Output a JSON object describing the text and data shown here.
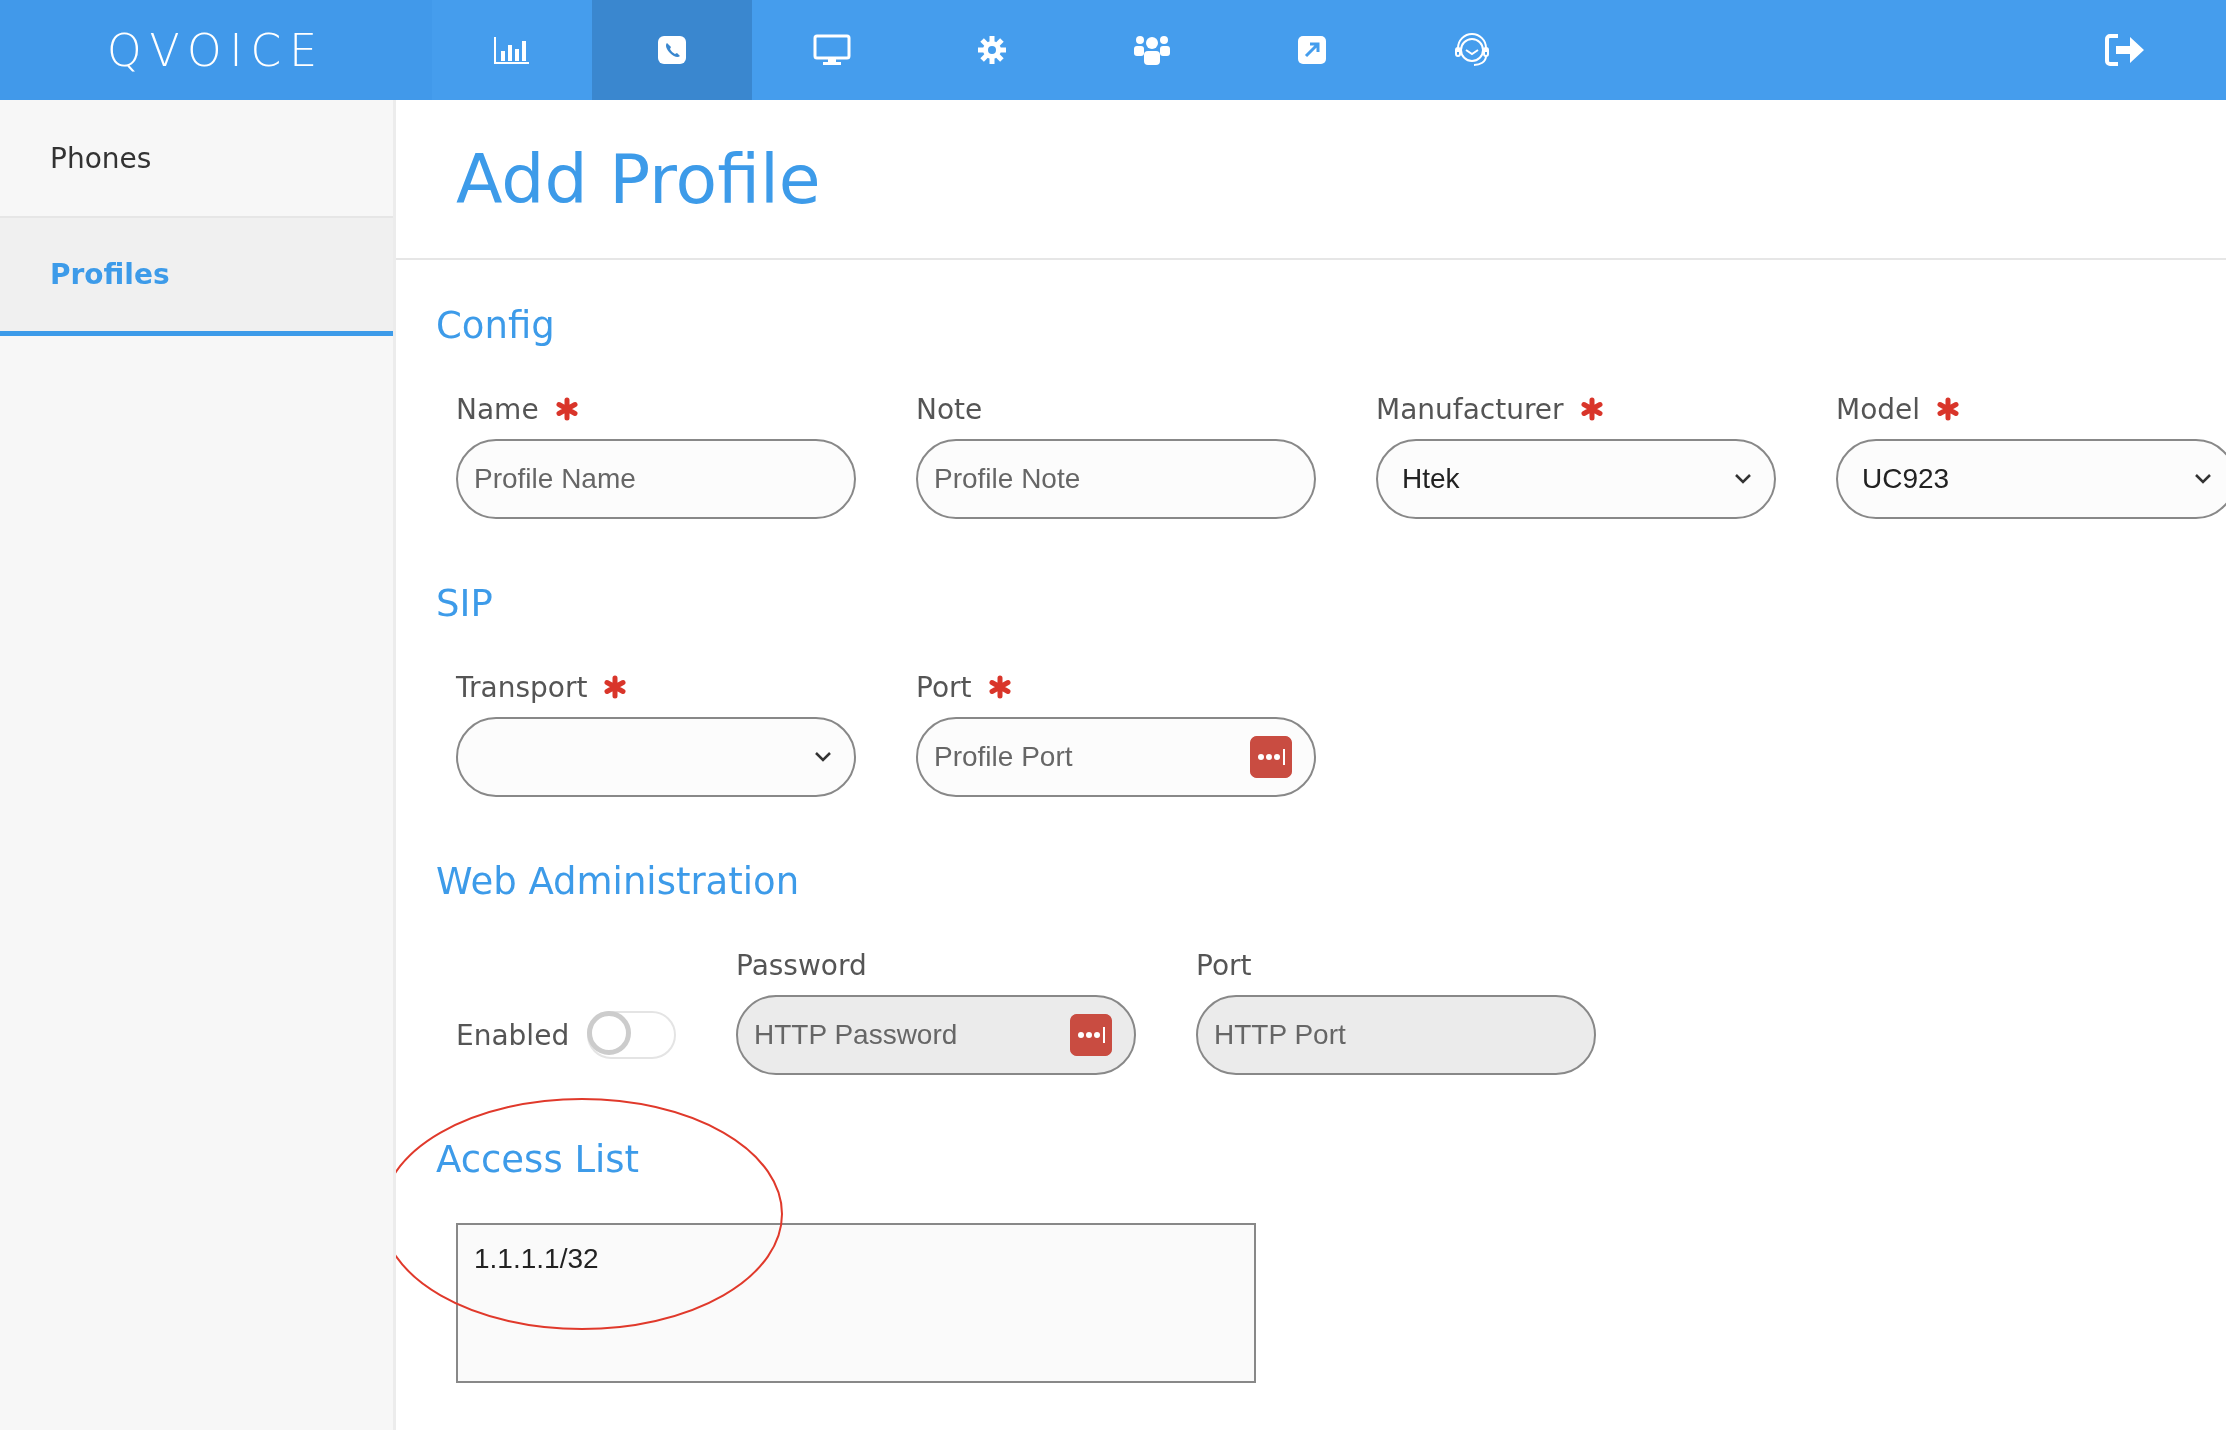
{
  "nav": {
    "logo": "QVOICE",
    "items": [
      {
        "kind": "chart",
        "selected": false
      },
      {
        "kind": "phone",
        "selected": true
      },
      {
        "kind": "monitor",
        "selected": false
      },
      {
        "kind": "gear",
        "selected": false
      },
      {
        "kind": "users",
        "selected": false
      },
      {
        "kind": "external",
        "selected": false
      },
      {
        "kind": "headset",
        "selected": false
      }
    ]
  },
  "sidebar": {
    "items": [
      {
        "label": "Phones",
        "selected": false
      },
      {
        "label": "Profiles",
        "selected": true
      }
    ]
  },
  "title": "Add Profile",
  "sections": [
    {
      "title": "Config",
      "fields": [
        {
          "kind": "input",
          "label": "Name",
          "required": true,
          "placeholder": "Profile Name",
          "disabled": false,
          "password_icon": false
        },
        {
          "kind": "input",
          "label": "Note",
          "required": false,
          "placeholder": "Profile Note",
          "disabled": false,
          "password_icon": false
        },
        {
          "kind": "select",
          "label": "Manufacturer",
          "required": true,
          "value": "Htek"
        },
        {
          "kind": "select",
          "label": "Model",
          "required": true,
          "value": "UC923"
        }
      ]
    },
    {
      "title": "SIP",
      "fields": [
        {
          "kind": "select",
          "label": "Transport",
          "required": true
        },
        {
          "kind": "input",
          "label": "Port",
          "required": true,
          "placeholder": "Profile Port",
          "disabled": false,
          "password_icon": true
        }
      ]
    },
    {
      "title": "Web Administration",
      "fields": [
        {
          "kind": "toggle",
          "label": "Enabled",
          "on": false
        },
        {
          "kind": "input",
          "label": "Password",
          "required": false,
          "placeholder": "HTTP Password",
          "disabled": true,
          "password_icon": true
        },
        {
          "kind": "input",
          "label": "Port",
          "required": false,
          "placeholder": "HTTP Port",
          "disabled": true,
          "password_icon": false
        }
      ]
    },
    {
      "title": "Access List",
      "fields": [
        {
          "kind": "textarea",
          "value": "1.1.1.1/32"
        }
      ]
    }
  ]
}
